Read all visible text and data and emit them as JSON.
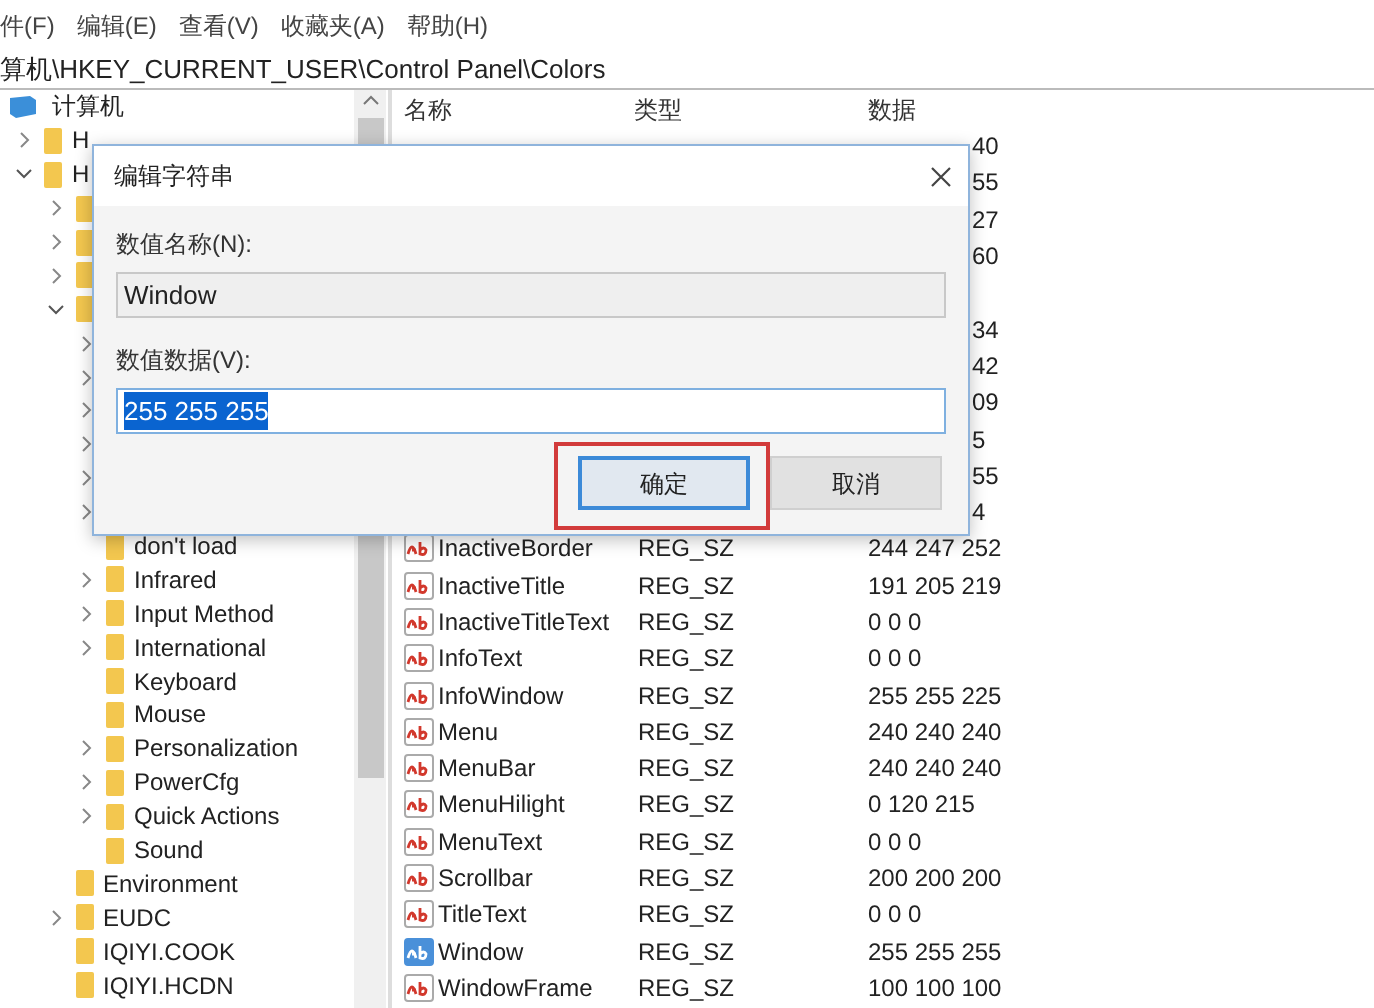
{
  "menu_bar": [
    "件(F)",
    "编辑(E)",
    "查看(V)",
    "收藏夹(A)",
    "帮助(H)"
  ],
  "address_bar": "算机\\HKEY_CURRENT_USER\\Control Panel\\Colors",
  "tree": {
    "label": "计算机",
    "children": [
      {
        "label": "H",
        "expanded": false
      },
      {
        "label": "H",
        "expanded": true,
        "children": [
          {
            "expanded": false
          },
          {
            "expanded": false
          },
          {
            "expanded": false
          },
          {
            "expanded": true,
            "children": [
              {
                "expanded": false
              },
              {
                "expanded": false
              },
              {
                "expanded": false
              },
              {
                "expanded": false
              },
              {
                "expanded": false
              },
              {
                "expanded": false
              },
              {
                "label": "don't load"
              },
              {
                "label": "Infrared",
                "expanded": false
              },
              {
                "label": "Input Method",
                "expanded": false
              },
              {
                "label": "International",
                "expanded": false
              },
              {
                "label": "Keyboard"
              },
              {
                "label": "Mouse"
              },
              {
                "label": "Personalization",
                "expanded": false
              },
              {
                "label": "PowerCfg",
                "expanded": false
              },
              {
                "label": "Quick Actions",
                "expanded": false
              },
              {
                "label": "Sound"
              }
            ]
          },
          {
            "label": "Environment"
          },
          {
            "label": "EUDC",
            "expanded": false
          },
          {
            "label": "IQIYI.COOK"
          },
          {
            "label": "IQIYI.HCDN"
          }
        ]
      }
    ]
  },
  "list": {
    "columns": [
      "名称",
      "类型",
      "数据"
    ],
    "rows": [
      {
        "data_fragment": "40"
      },
      {
        "data_fragment": "55"
      },
      {
        "data_fragment": "27"
      },
      {
        "data_fragment": "60"
      },
      {},
      {
        "data_fragment": "34"
      },
      {
        "data_fragment": "42"
      },
      {
        "data_fragment": "09"
      },
      {
        "data_fragment": "5"
      },
      {
        "data_fragment": "55"
      },
      {
        "data_fragment": "4"
      },
      {
        "name": "InactiveBorder",
        "type": "REG_SZ",
        "data": "244 247 252",
        "selected": false
      },
      {
        "name": "InactiveTitle",
        "type": "REG_SZ",
        "data": "191 205 219",
        "selected": false
      },
      {
        "name": "InactiveTitleText",
        "type": "REG_SZ",
        "data": "0 0 0",
        "selected": false
      },
      {
        "name": "InfoText",
        "type": "REG_SZ",
        "data": "0 0 0",
        "selected": false
      },
      {
        "name": "InfoWindow",
        "type": "REG_SZ",
        "data": "255 255 225",
        "selected": false
      },
      {
        "name": "Menu",
        "type": "REG_SZ",
        "data": "240 240 240",
        "selected": false
      },
      {
        "name": "MenuBar",
        "type": "REG_SZ",
        "data": "240 240 240",
        "selected": false
      },
      {
        "name": "MenuHilight",
        "type": "REG_SZ",
        "data": "0 120 215",
        "selected": false
      },
      {
        "name": "MenuText",
        "type": "REG_SZ",
        "data": "0 0 0",
        "selected": false
      },
      {
        "name": "Scrollbar",
        "type": "REG_SZ",
        "data": "200 200 200",
        "selected": false
      },
      {
        "name": "TitleText",
        "type": "REG_SZ",
        "data": "0 0 0",
        "selected": false
      },
      {
        "name": "Window",
        "type": "REG_SZ",
        "data": "255 255 255",
        "selected": true
      },
      {
        "name": "WindowFrame",
        "type": "REG_SZ",
        "data": "100 100 100",
        "selected": false
      }
    ]
  },
  "dialog": {
    "title": "编辑字符串",
    "name_label": "数值名称(N):",
    "name_value": "Window",
    "data_label": "数值数据(V):",
    "data_value": "255 255 255",
    "data_selected": true,
    "buttons": [
      {
        "label": "确定",
        "focused": true,
        "highlighted": true
      },
      {
        "label": "取消",
        "focused": false,
        "highlighted": false
      }
    ]
  }
}
